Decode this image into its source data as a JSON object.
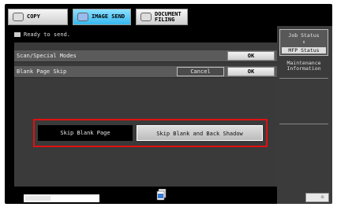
{
  "tabs": [
    {
      "label": "COPY",
      "active": false
    },
    {
      "label": "IMAGE SEND",
      "active": true
    },
    {
      "label_line1": "DOCUMENT",
      "label_line2": "FILING",
      "active": false
    }
  ],
  "status": {
    "text": "Ready to send."
  },
  "main": {
    "row1": {
      "label": "Scan/Special Modes",
      "ok_label": "OK"
    },
    "row2": {
      "label": "Blank Page Skip",
      "cancel_label": "Cancel",
      "ok_label": "OK"
    },
    "options": [
      {
        "label": "Skip Blank Page",
        "selected": true
      },
      {
        "label": "Skip Blank and Back Shadow",
        "selected": false
      }
    ]
  },
  "right_panel": {
    "job_status": {
      "label": "Job Status",
      "arrow": "⇕",
      "sub_label": "MFP Status"
    },
    "maintenance": {
      "line1": "Maintenance",
      "line2": "Information"
    }
  },
  "icons": {
    "status": "envelope-icon",
    "job_queue": "document-queue-icon",
    "brightness": "brightness-icon"
  },
  "colors": {
    "highlight": "#e01010",
    "active_tab": "#35b7ee"
  }
}
